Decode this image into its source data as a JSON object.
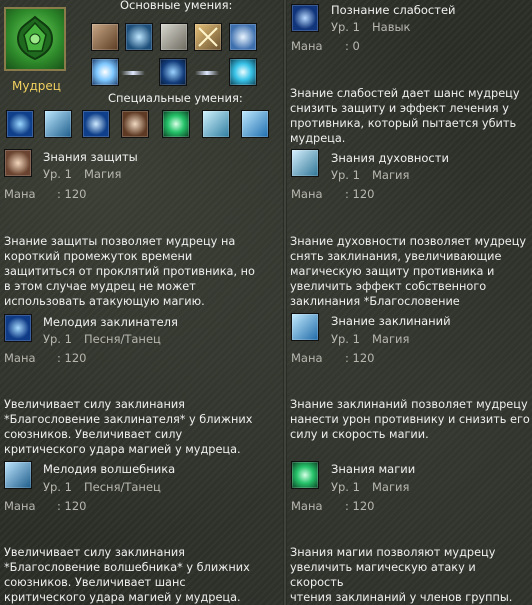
{
  "class_panel": {
    "class_name": "Мудрец",
    "basic_skills_title": "Основные умения:",
    "special_skills_title": "Специальные умения:",
    "basic_icons": [
      "armor-icon",
      "wand-icon",
      "gloves-icon",
      "crossed-staves-icon",
      "rune-icon"
    ],
    "chain_icons": [
      "light-orb-icon",
      "arrow-right-icon",
      "vortex-icon",
      "arrow-right-icon",
      "star-burst-icon"
    ],
    "special_icons": [
      "blue-rune-icon",
      "wave-icon",
      "blue-rune-icon",
      "shield-icon",
      "green-orb-icon",
      "spirit-icon",
      "lightning-icon"
    ]
  },
  "skills": [
    {
      "name": "Познание слабостей",
      "level": "Ур. 1",
      "type": "Навык",
      "mana_label": "Мана",
      "mana_value": ": 0",
      "description": "Знание слабостей дает шанс мудрецу\nснизить защиту и эффект лечения у\nпротивника, который пытается убить\nмудреца."
    },
    {
      "name": "Знания защиты",
      "level": "Ур. 1",
      "type": "Магия",
      "mana_label": "Мана",
      "mana_value": ": 120",
      "description": "Знание защиты позволяет мудрецу на\nкороткий промежуток времени\nзащититься от проклятий противника, но\nв этом случае мудрец не может\nиспользовать атакующую магию."
    },
    {
      "name": "Знания духовности",
      "level": "Ур. 1",
      "type": "Магия",
      "mana_label": "Мана",
      "mana_value": ": 120",
      "description": "Знание духовности позволяет мудрецу\nснять заклинания, увеличивающие\nмагическую защиту противника и\nувеличить эффект собственного\nзаклинания *Благословение"
    },
    {
      "name": "Мелодия заклинателя",
      "level": "Ур. 1",
      "type": "Песня/Танец",
      "mana_label": "Мана",
      "mana_value": ": 120",
      "description": "Увеличивает силу заклинания\n*Благословение заклинателя* у ближних\nсоюзников. Увеличивает силу\nкритического удара магией у мудреца."
    },
    {
      "name": "Знание заклинаний",
      "level": "Ур. 1",
      "type": "Магия",
      "mana_label": "Мана",
      "mana_value": ": 120",
      "description": "Знание заклинаний позволяет мудрецу\nнанести урон противнику и снизить его\nсилу и скорость магии."
    },
    {
      "name": "Мелодия волшебника",
      "level": "Ур. 1",
      "type": "Песня/Танец",
      "mana_label": "Мана",
      "mana_value": ": 120",
      "description": "Увеличивает силу заклинания\n*Благословение волшебника* у ближних\nсоюзников. Увеличивает шанс\nкритического удара магией у мудреца."
    },
    {
      "name": "Знания магии",
      "level": "Ур. 1",
      "type": "Магия",
      "mana_label": "Мана",
      "mana_value": ": 120",
      "description": "Знания магии позволяют мудрецу\nувеличить магическую атаку и скорость\nчтения заклинаний у членов группы."
    }
  ]
}
